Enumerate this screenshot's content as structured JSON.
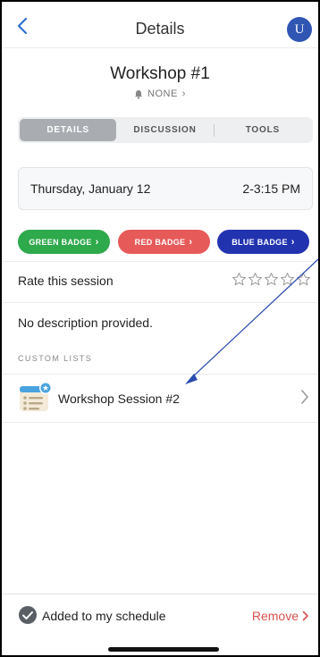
{
  "header": {
    "title": "Details",
    "avatar_letter": "U"
  },
  "session": {
    "title": "Workshop #1",
    "alert_label": "NONE",
    "alert_chevron": "›"
  },
  "tabs": [
    {
      "label": "DETAILS",
      "active": true
    },
    {
      "label": "DISCUSSION",
      "active": false
    },
    {
      "label": "TOOLS",
      "active": false
    }
  ],
  "schedule": {
    "date": "Thursday, January 12",
    "time": "2-3:15 PM"
  },
  "badges": [
    {
      "label": "GREEN BADGE",
      "color": "#2ea94b"
    },
    {
      "label": "RED BADGE",
      "color": "#e65a5a"
    },
    {
      "label": "BLUE BADGE",
      "color": "#2233b0"
    }
  ],
  "rating": {
    "label": "Rate this session",
    "stars": 5,
    "value": 0
  },
  "description": "No description provided.",
  "custom_lists": {
    "header": "CUSTOM LISTS",
    "items": [
      {
        "label": "Workshop Session #2"
      }
    ]
  },
  "footer": {
    "status": "Added to my schedule",
    "remove_label": "Remove"
  },
  "colors": {
    "accent": "#2f6fd0",
    "avatar": "#2f56b3",
    "remove": "#d9534f",
    "annotation": "#2a4cad"
  }
}
